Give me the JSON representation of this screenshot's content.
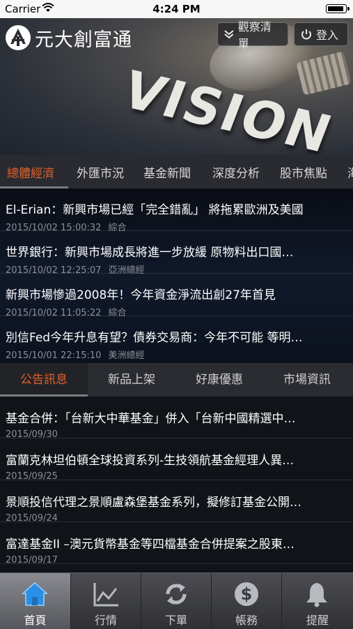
{
  "status_bar": {
    "carrier": "Carrier",
    "time": "4:24 PM"
  },
  "header": {
    "logo_text": "元大創富通",
    "watchlist_label": "觀察清單",
    "login_label": "登入"
  },
  "hero": {
    "banner_text": "VISION"
  },
  "news_tabs": [
    "總體經濟",
    "外匯市況",
    "基金新聞",
    "深度分析",
    "股市焦點",
    "海"
  ],
  "news": [
    {
      "title": "El-Erian：新興市場已經「完全錯亂」 將拖累歐洲及美國",
      "datetime": "2015/10/02 15:00:32",
      "category": "綜合"
    },
    {
      "title": "世界銀行：新興市場成長將進一步放緩 原物料出口國…",
      "datetime": "2015/10/02 12:25:07",
      "category": "亞洲總經"
    },
    {
      "title": "新興市場慘過2008年！今年資金淨流出創27年首見",
      "datetime": "2015/10/02 11:05:22",
      "category": "綜合"
    },
    {
      "title": "別信Fed今年升息有望？債券交易商：今年不可能 等明…",
      "datetime": "2015/10/01 22:15:10",
      "category": "美洲總經"
    }
  ],
  "notice_tabs": [
    "公告訊息",
    "新品上架",
    "好康優惠",
    "市場資訊"
  ],
  "notices": [
    {
      "title": "基金合併：「台新大中華基金」併入「台新中國精選中…",
      "date": "2015/09/30"
    },
    {
      "title": "富蘭克林坦伯頓全球投資系列-生技領航基金經理人異…",
      "date": "2015/09/25"
    },
    {
      "title": "景順投信代理之景順盧森堡基金系列，擬修訂基金公開…",
      "date": "2015/09/24"
    },
    {
      "title": "富達基金II –澳元貨幣基金等四檔基金合併提案之股東…",
      "date": "2015/09/17"
    }
  ],
  "tab_bar": [
    {
      "label": "首頁",
      "icon": "home-icon"
    },
    {
      "label": "行情",
      "icon": "chart-icon"
    },
    {
      "label": "下單",
      "icon": "refresh-icon"
    },
    {
      "label": "帳務",
      "icon": "dollar-icon"
    },
    {
      "label": "提醒",
      "icon": "bell-icon"
    }
  ],
  "colors": {
    "accent": "#e2622b",
    "home_icon": "#2a8fe6"
  }
}
